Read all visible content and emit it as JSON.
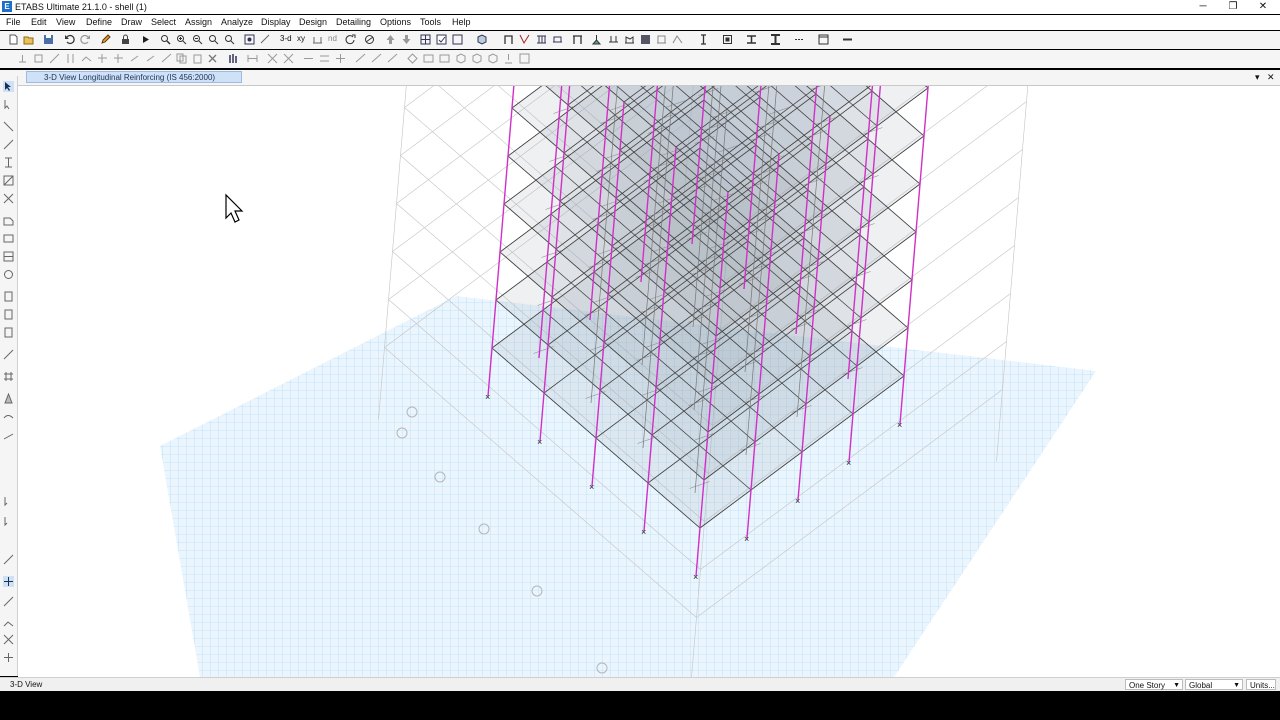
{
  "window": {
    "title": "ETABS Ultimate 21.1.0 - shell (1)",
    "app_icon_letter": "E",
    "minimize": "─",
    "restore": "❐",
    "close": "✕"
  },
  "menu": [
    "File",
    "Edit",
    "View",
    "Define",
    "Draw",
    "Select",
    "Assign",
    "Analyze",
    "Display",
    "Design",
    "Detailing",
    "Options",
    "Tools",
    "Help"
  ],
  "toolbar": {
    "view_3d_label": "3-d",
    "plan_label": "xy",
    "elev_label": "nd"
  },
  "tab": {
    "label": "3-D View  Longitudinal Reinforcing  (IS 456:2000)",
    "dropdown": "▾",
    "close": "✕"
  },
  "status": {
    "view_name": "3-D View",
    "story_combo": "One Story",
    "coord_combo": "Global",
    "units_button": "Units..."
  },
  "colors": {
    "accent": "#1e6fc8",
    "column_magenta": "#d030c8",
    "grid_blue": "#8ec3ea",
    "tab_bg": "#cfe1f6"
  }
}
